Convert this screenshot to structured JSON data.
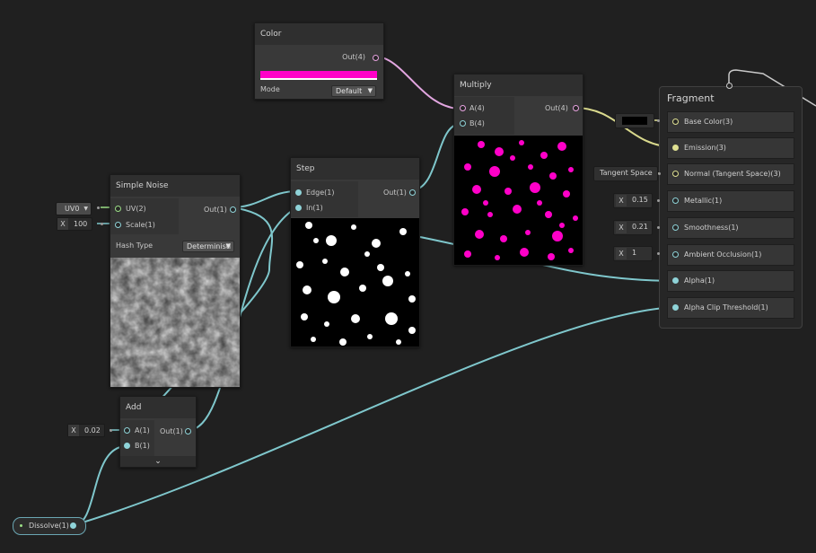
{
  "colors": {
    "background": "#202020",
    "wire_cyan": "#7fc7cc",
    "wire_pink": "#e2a6e0",
    "wire_yellow": "#d9d98d",
    "magenta_color": "#ff00c8"
  },
  "color_node": {
    "title": "Color",
    "out_label": "Out(4)",
    "mode_label": "Mode",
    "mode_value": "Default"
  },
  "multiply_node": {
    "title": "Multiply",
    "in_a": "A(4)",
    "in_b": "B(4)",
    "out_label": "Out(4)"
  },
  "step_node": {
    "title": "Step",
    "in_edge": "Edge(1)",
    "in_in": "In(1)",
    "out_label": "Out(1)"
  },
  "noise_node": {
    "title": "Simple Noise",
    "in_uv": "UV(2)",
    "in_scale": "Scale(1)",
    "out_label": "Out(1)",
    "hash_label": "Hash Type",
    "hash_value": "Deterministi",
    "uv_value": "UV0",
    "scale_x": "X",
    "scale_value": "100"
  },
  "add_node": {
    "title": "Add",
    "in_a": "A(1)",
    "in_b": "B(1)",
    "out_label": "Out(1)",
    "a_x": "X",
    "a_value": "0.02"
  },
  "property_node": {
    "label": "Dissolve(1)"
  },
  "fragment": {
    "title": "Fragment",
    "blocks": [
      {
        "label": "Base Color(3)"
      },
      {
        "label": "Emission(3)"
      },
      {
        "label": "Normal (Tangent Space)(3)"
      },
      {
        "label": "Metallic(1)"
      },
      {
        "label": "Smoothness(1)"
      },
      {
        "label": "Ambient Occlusion(1)"
      },
      {
        "label": "Alpha(1)"
      },
      {
        "label": "Alpha Clip Threshold(1)"
      }
    ],
    "normal_space": "Tangent Space",
    "metallic_x": "X",
    "metallic_value": "0.15",
    "smoothness_x": "X",
    "smoothness_value": "0.21",
    "ao_x": "X",
    "ao_value": "1",
    "base_color_value": "#000000"
  }
}
